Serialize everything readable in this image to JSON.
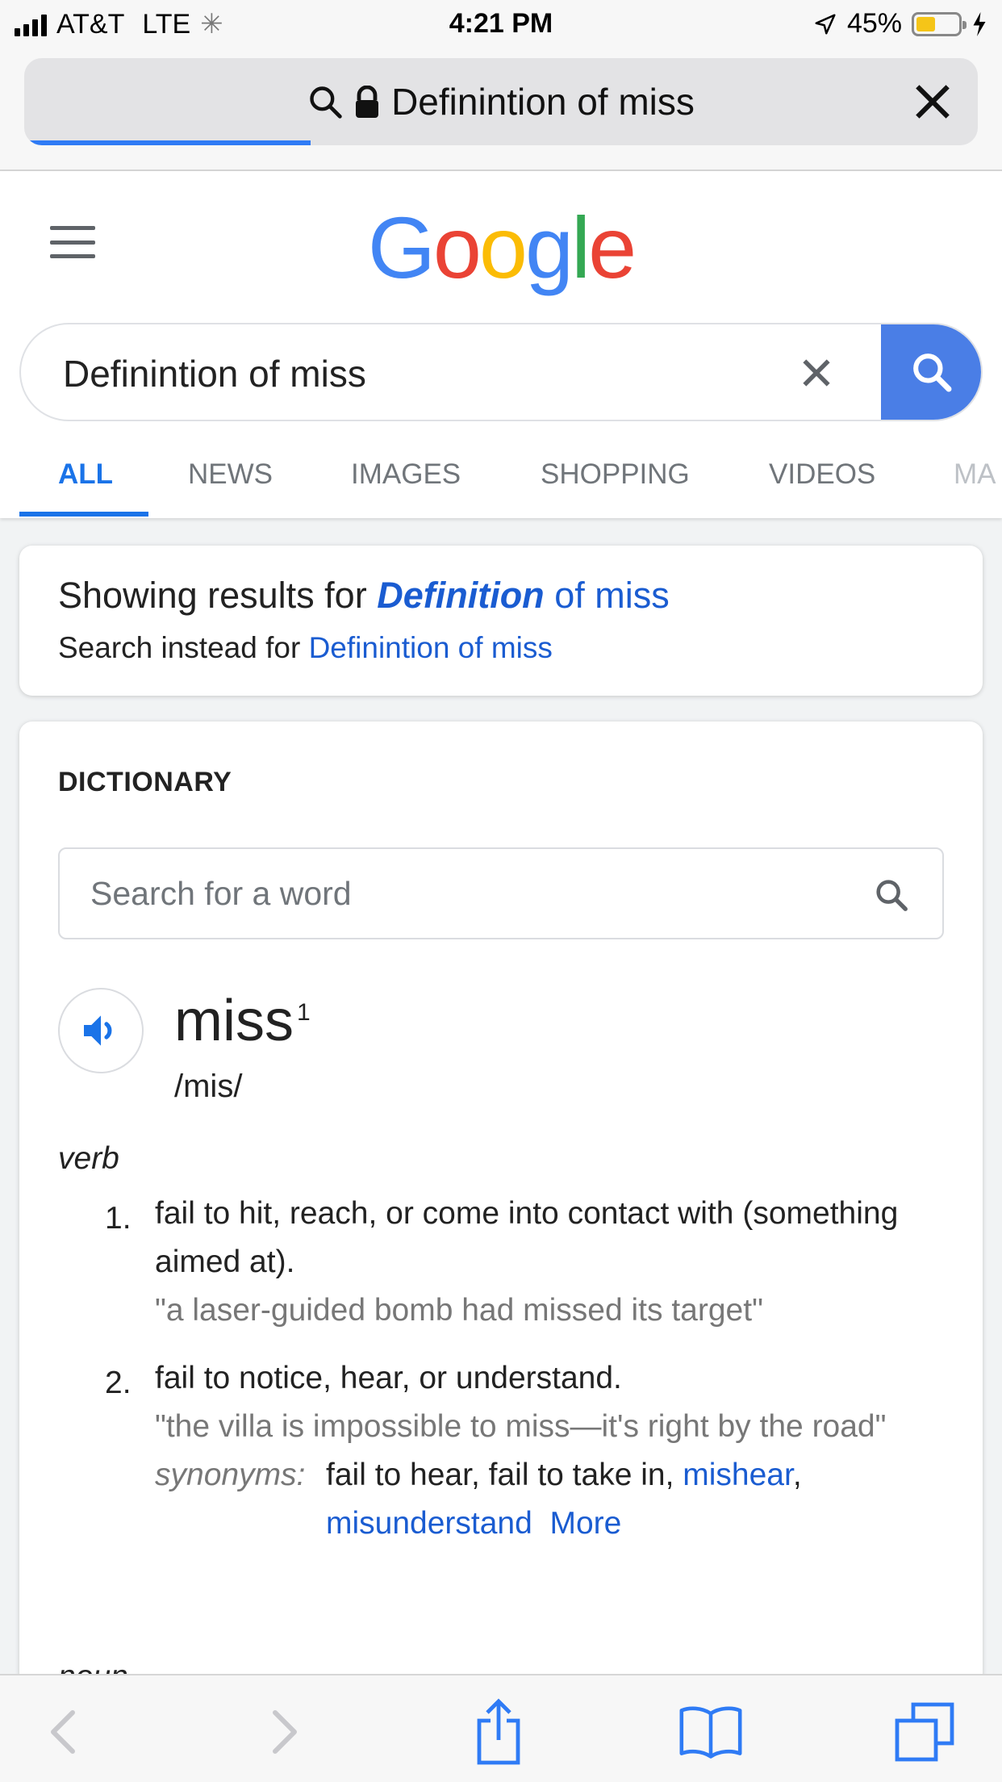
{
  "status_bar": {
    "carrier": "AT&T",
    "network": "LTE",
    "time": "4:21 PM",
    "battery_percent": "45%",
    "battery_level": 0.45
  },
  "url_bar": {
    "text": "Definintion of miss",
    "load_progress": 0.3
  },
  "google": {
    "logo_letters": [
      "G",
      "o",
      "o",
      "g",
      "l",
      "e"
    ],
    "search_value": "Definintion of miss",
    "tabs": [
      "ALL",
      "NEWS",
      "IMAGES",
      "SHOPPING",
      "VIDEOS",
      "MA"
    ],
    "active_tab": "ALL"
  },
  "spelling": {
    "showing_prefix": "Showing results for",
    "corrected_word": "Definition",
    "corrected_rest": "of miss",
    "instead_prefix": "Search instead for",
    "original_query": "Definintion of miss"
  },
  "dictionary": {
    "title": "DICTIONARY",
    "search_placeholder": "Search for a word",
    "word": "miss",
    "superscript": "1",
    "pronunciation": "/mis/",
    "pos_verb": "verb",
    "senses": [
      {
        "num": "1.",
        "definition": "fail to hit, reach, or come into contact with (something aimed at).",
        "example": "\"a laser-guided bomb had missed its target\""
      },
      {
        "num": "2.",
        "definition": "fail to notice, hear, or understand.",
        "example": "\"the villa is impossible to miss—it's right by the road\"",
        "synonyms_label": "synonyms:",
        "synonyms_plain": "fail to hear, fail to take in,",
        "synonyms_link1": "mishear",
        "synonyms_link2": "misunderstand",
        "more": "More"
      }
    ],
    "pos_noun": "noun"
  },
  "colors": {
    "accent_blue": "#1a73e8",
    "search_button": "#4a7ee6",
    "progress_blue": "#2f7bf5",
    "battery_yellow": "#f5c518"
  },
  "icons": {
    "browser_search": "search-icon",
    "lock": "lock-icon",
    "close": "close-icon",
    "menu": "hamburger-icon",
    "speaker": "speaker-icon",
    "toolbar": [
      "back-icon",
      "forward-icon",
      "share-icon",
      "bookmarks-icon",
      "tabs-icon"
    ]
  }
}
